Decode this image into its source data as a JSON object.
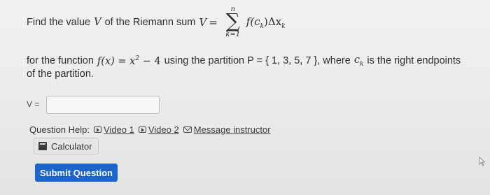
{
  "question": {
    "prefix": "Find the value",
    "var_V": "V",
    "after_V": "of the Riemann sum",
    "lhs": "V",
    "equals": "=",
    "sum_upper": "n",
    "sum_symbol": "∑",
    "sum_lower": "k=1",
    "summand": "f(c",
    "summand_sub": "k",
    "summand_mid": ")Δx",
    "summand_sub2": "k",
    "line2_prefix": "for the function",
    "func": "f(x) = x",
    "func_exp": "2",
    "func_rest": "− 4",
    "line2_mid": "using the partition P = { 1, 3, 5, 7 }, where",
    "c_var": "c",
    "c_sub": "k",
    "line2_suffix": "is the right endpoints",
    "line3": "of the partition."
  },
  "answer": {
    "label": "V =",
    "value": ""
  },
  "help": {
    "label": "Question Help:",
    "video1": "Video 1",
    "video2": "Video 2",
    "message": "Message instructor"
  },
  "calculator": {
    "label": "Calculator"
  },
  "submit": {
    "label": "Submit Question"
  },
  "colors": {
    "submit_bg": "#1e65c9",
    "background": "#ecebea"
  }
}
